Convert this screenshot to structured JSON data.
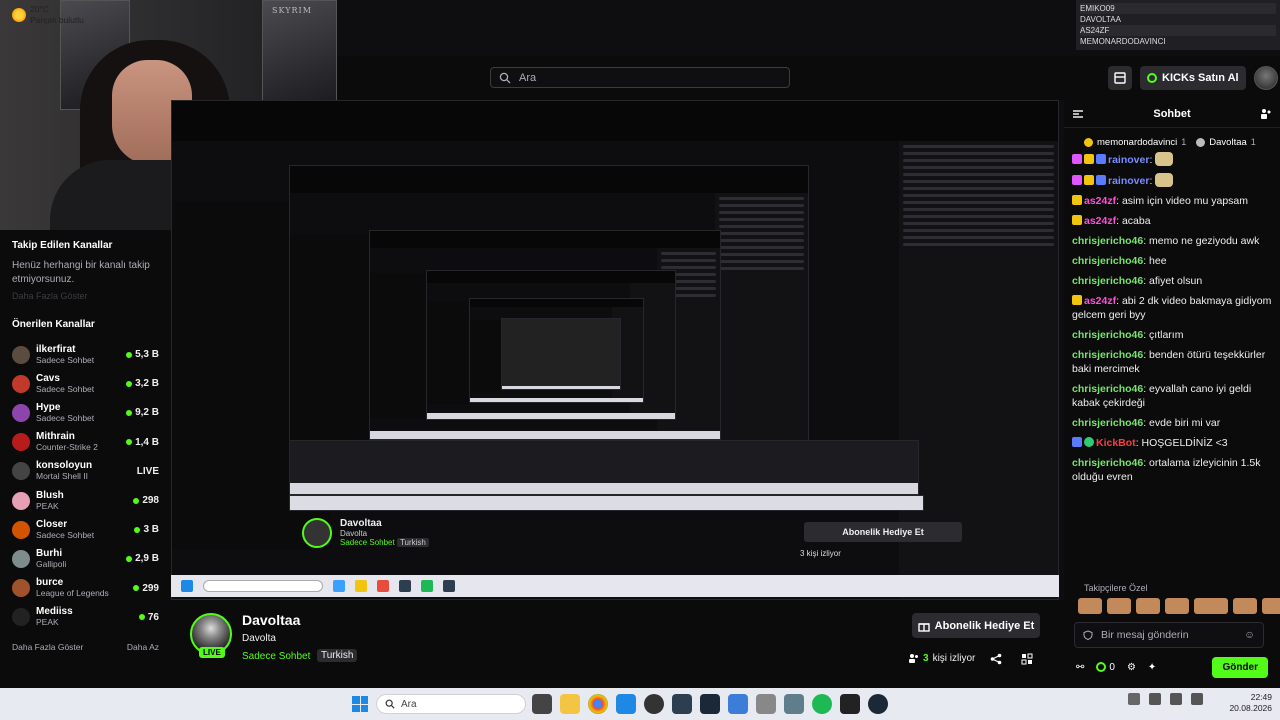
{
  "webcam": {
    "poster_text": "SKYRIM"
  },
  "search": {
    "placeholder": "Ara"
  },
  "mod_list": [
    "EMIKO09",
    "DAVOLTAA",
    "AS24ZF",
    "MEMONARDODAVINCI"
  ],
  "header": {
    "kicks_label": "KICKs Satın Al"
  },
  "sidebar": {
    "followed_title": "Takip Edilen Kanallar",
    "followed_empty": "Henüz herhangi bir kanalı takip etmiyorsunuz.",
    "followed_more_dim": "Daha Fazla Göster",
    "suggested_title": "Önerilen Kanallar",
    "channels": [
      {
        "name": "ilkerfirat",
        "game": "Sadece Sohbet",
        "viewers": "5,3 B",
        "color": "#5a4d3f"
      },
      {
        "name": "Cavs",
        "game": "Sadece Sohbet",
        "viewers": "3,2 B",
        "color": "#c0392b"
      },
      {
        "name": "Hype",
        "game": "Sadece Sohbet",
        "viewers": "9,2 B",
        "color": "#8e44ad"
      },
      {
        "name": "Mithrain",
        "game": "Counter-Strike 2",
        "viewers": "1,4 B",
        "color": "#b71c1c"
      },
      {
        "name": "konsoloyun",
        "game": "Mortal Shell II",
        "viewers": "LIVE",
        "color": "#444"
      },
      {
        "name": "Blush",
        "game": "PEAK",
        "viewers": "298",
        "color": "#e5a1b3"
      },
      {
        "name": "Closer",
        "game": "Sadece Sohbet",
        "viewers": "3 B",
        "color": "#d35400"
      },
      {
        "name": "Burhi",
        "game": "Gallipoli",
        "viewers": "2,9 B",
        "color": "#7f8c8d"
      },
      {
        "name": "burce",
        "game": "League of Legends",
        "viewers": "299",
        "color": "#a0522d"
      },
      {
        "name": "Mediiss",
        "game": "PEAK",
        "viewers": "76",
        "color": "#222"
      }
    ],
    "show_more": "Daha Fazla Göster",
    "show_less": "Daha Az"
  },
  "inner_stream": {
    "name": "Davoltaa",
    "title": "Davolta",
    "category": "Sadece Sohbet",
    "tag": "Turkish",
    "sub_label": "Abonelik Hediye Et",
    "viewers": "3 kişi izliyor"
  },
  "streamer": {
    "name": "Davoltaa",
    "title": "Davolta",
    "category": "Sadece Sohbet",
    "tag": "Turkish",
    "live": "LIVE",
    "sub_label": "Abonelik Hediye Et",
    "viewer_count": "3",
    "viewer_suffix": "kişi izliyor"
  },
  "chat": {
    "title": "Sohbet",
    "pinned": [
      {
        "name": "memonardodavinci",
        "count": "1",
        "color": "#f1c40f"
      },
      {
        "name": "Davoltaa",
        "count": "1",
        "color": "#bbb"
      }
    ],
    "messages": [
      {
        "user": "rainover",
        "text": "",
        "color": "blue",
        "emote": true
      },
      {
        "user": "rainover",
        "text": "",
        "color": "blue",
        "emote": true
      },
      {
        "user": "as24zf",
        "text": "asim için video mu yapsam",
        "color": "pink"
      },
      {
        "user": "as24zf",
        "text": "acaba",
        "color": "pink"
      },
      {
        "user": "chrisjericho46",
        "text": "memo ne geziyodu awk",
        "color": "green"
      },
      {
        "user": "chrisjericho46",
        "text": "hee",
        "color": "green"
      },
      {
        "user": "chrisjericho46",
        "text": "afiyet olsun",
        "color": "green"
      },
      {
        "user": "as24zf",
        "text": "abi 2 dk video bakmaya gidiyom gelcem geri byy",
        "color": "pink"
      },
      {
        "user": "chrisjericho46",
        "text": "çıtlarım",
        "color": "green"
      },
      {
        "user": "chrisjericho46",
        "text": "benden ötürü teşekkürler baki mercimek",
        "color": "green"
      },
      {
        "user": "chrisjericho46",
        "text": "eyvallah cano iyi geldi kabak çekirdeği",
        "color": "green"
      },
      {
        "user": "chrisjericho46",
        "text": "evde biri mi var",
        "color": "green"
      },
      {
        "user": "KickBot",
        "text": "HOŞGELDİNİZ <3",
        "color": "red"
      },
      {
        "user": "chrisjericho46",
        "text": "ortalama izleyicinin 1.5k olduğu evren",
        "color": "green"
      }
    ],
    "supporters_label": "Takipçilere Özel",
    "input_placeholder": "Bir mesaj gönderin",
    "kicks_count": "0",
    "send_label": "Gönder"
  },
  "taskbar": {
    "temp": "20°C",
    "weather": "Parçalı bulutlu",
    "search_placeholder": "Ara",
    "time": "22:49",
    "date": "20.08.2026"
  }
}
